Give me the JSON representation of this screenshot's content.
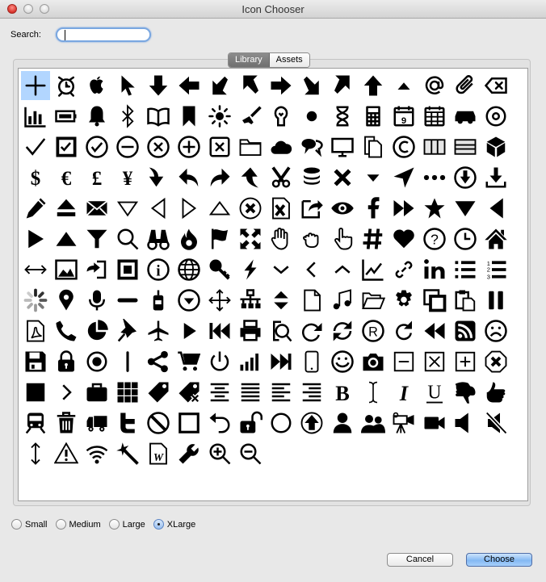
{
  "window": {
    "title": "Icon Chooser"
  },
  "search": {
    "label": "Search:",
    "value": "",
    "placeholder": ""
  },
  "tabs": [
    {
      "label": "Library",
      "active": true
    },
    {
      "label": "Assets",
      "active": false
    }
  ],
  "selected_index": 0,
  "icons": [
    "plus",
    "alarm-clock",
    "apple",
    "cursor-arrow",
    "arrow-down",
    "arrow-left",
    "arrow-down-left",
    "arrow-up-left",
    "arrow-right",
    "arrow-down-right",
    "arrow-up-right",
    "arrow-up",
    "caret-up",
    "at-sign",
    "paperclip",
    "backspace",
    "bar-chart",
    "battery",
    "bell",
    "bluetooth",
    "book",
    "bookmark",
    "sun",
    "brush",
    "lightbulb",
    "dot",
    "hourglass",
    "calculator",
    "calendar",
    "calendar-grid",
    "car",
    "disc",
    "checkmark",
    "checkbox-checked",
    "check-circle",
    "minus-circle",
    "x-circle",
    "plus-circle",
    "x-square",
    "folder",
    "cloud",
    "chat-bubbles",
    "monitor",
    "copy",
    "copyright",
    "columns",
    "rows",
    "cube",
    "dollar",
    "euro",
    "pound",
    "yen",
    "curve-arrow-down",
    "reply",
    "share-arrow",
    "curve-arrow-up",
    "scissors",
    "database",
    "x-mark",
    "caret-down",
    "location-arrow",
    "ellipsis",
    "download-circle",
    "download",
    "pencil",
    "eject",
    "envelope",
    "triangle-down-outline",
    "triangle-left-outline",
    "triangle-right-outline",
    "triangle-up-outline",
    "x-circle-outline",
    "excel-file",
    "external-share",
    "eye",
    "facebook",
    "fast-forward",
    "star",
    "triangle-down",
    "triangle-left",
    "play",
    "triangle-up",
    "filter",
    "magnifier",
    "binoculars",
    "fire",
    "flag",
    "fullscreen",
    "hand-open",
    "hand-grab",
    "hand-pointer",
    "hashtag",
    "heart",
    "question-circle",
    "clock",
    "home",
    "arrows-horizontal",
    "image",
    "login",
    "stop-square",
    "info",
    "globe",
    "key",
    "lightning",
    "chevron-down",
    "chevron-left",
    "chevron-up",
    "line-chart",
    "link",
    "linkedin",
    "list",
    "numbered-list",
    "spinner",
    "map-pin",
    "microphone",
    "minus",
    "mobile",
    "circle-caret-down",
    "move",
    "sitemap",
    "sort",
    "file",
    "music",
    "folder-open",
    "gear",
    "windows",
    "clipboard",
    "pause",
    "pdf",
    "phone",
    "pie-chart",
    "pushpin",
    "airplane",
    "play-small",
    "skip-back",
    "printer",
    "search-document",
    "redo",
    "refresh",
    "registered",
    "rotate",
    "rewind",
    "rss",
    "sad-face",
    "save",
    "lock",
    "radio-button",
    "vertical-bar",
    "share",
    "cart",
    "power",
    "signal",
    "skip-forward",
    "smartphone",
    "smile",
    "camera",
    "minus-square",
    "x-square-outline",
    "plus-square",
    "x-octagon",
    "square-solid",
    "chevron-right",
    "briefcase",
    "grid",
    "tag",
    "tag-remove",
    "align-center",
    "align-justify",
    "align-left",
    "align-right",
    "bold",
    "text-cursor",
    "italic",
    "underline",
    "thumbs-down",
    "thumbs-up",
    "train",
    "trash",
    "truck",
    "twitter",
    "ban",
    "square-outline",
    "undo",
    "unlock",
    "circle-outline",
    "arrow-up-circle",
    "user",
    "users",
    "video-camera",
    "video",
    "volume",
    "mute",
    "arrows-vertical",
    "warning",
    "wifi",
    "magic-wand",
    "word-file",
    "wrench",
    "zoom-in",
    "zoom-out"
  ],
  "sizes": [
    {
      "label": "Small",
      "checked": false
    },
    {
      "label": "Medium",
      "checked": false
    },
    {
      "label": "Large",
      "checked": false
    },
    {
      "label": "XLarge",
      "checked": true
    }
  ],
  "buttons": {
    "cancel": "Cancel",
    "choose": "Choose"
  }
}
